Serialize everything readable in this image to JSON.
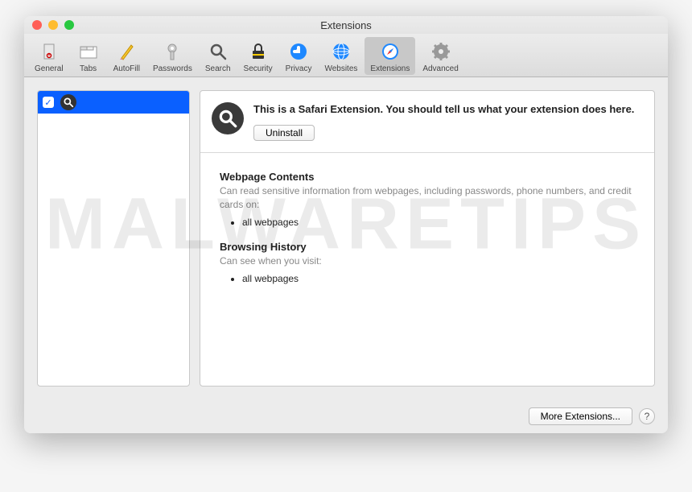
{
  "window": {
    "title": "Extensions"
  },
  "toolbar": {
    "items": [
      {
        "label": "General"
      },
      {
        "label": "Tabs"
      },
      {
        "label": "AutoFill"
      },
      {
        "label": "Passwords"
      },
      {
        "label": "Search"
      },
      {
        "label": "Security"
      },
      {
        "label": "Privacy"
      },
      {
        "label": "Websites"
      },
      {
        "label": "Extensions"
      },
      {
        "label": "Advanced"
      }
    ]
  },
  "sidebar": {
    "item": {
      "checked": true
    }
  },
  "extension": {
    "description": "This is a Safari Extension. You should tell us what your extension does here.",
    "uninstall_label": "Uninstall",
    "sections": {
      "webpage": {
        "title": "Webpage Contents",
        "text": "Can read sensitive information from webpages, including passwords, phone numbers, and credit cards on:",
        "items": [
          "all webpages"
        ]
      },
      "history": {
        "title": "Browsing History",
        "text": "Can see when you visit:",
        "items": [
          "all webpages"
        ]
      }
    }
  },
  "footer": {
    "more_label": "More Extensions...",
    "help_label": "?"
  },
  "watermark": "MALWARETIPS"
}
